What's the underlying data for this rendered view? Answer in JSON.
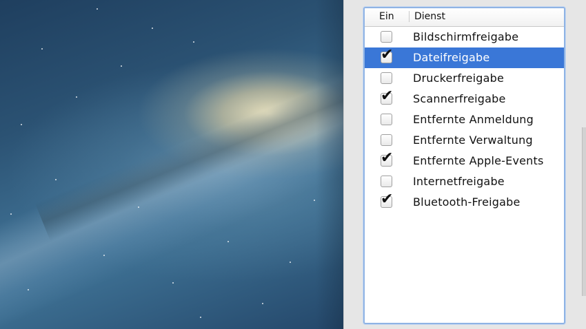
{
  "table": {
    "header": {
      "col_enabled": "Ein",
      "col_service": "Dienst"
    },
    "rows": [
      {
        "label": "Bildschirmfreigabe",
        "checked": false,
        "selected": false
      },
      {
        "label": "Dateifreigabe",
        "checked": true,
        "selected": true
      },
      {
        "label": "Druckerfreigabe",
        "checked": false,
        "selected": false
      },
      {
        "label": "Scannerfreigabe",
        "checked": true,
        "selected": false
      },
      {
        "label": "Entfernte Anmeldung",
        "checked": false,
        "selected": false
      },
      {
        "label": "Entfernte Verwaltung",
        "checked": false,
        "selected": false
      },
      {
        "label": "Entfernte Apple-Events",
        "checked": true,
        "selected": false
      },
      {
        "label": "Internetfreigabe",
        "checked": false,
        "selected": false
      },
      {
        "label": "Bluetooth-Freigabe",
        "checked": true,
        "selected": false
      }
    ]
  },
  "colors": {
    "selection": "#3a77d7",
    "focus_ring": "#8fb3e4"
  },
  "icons": {
    "checkmark": "checkmark-icon"
  }
}
